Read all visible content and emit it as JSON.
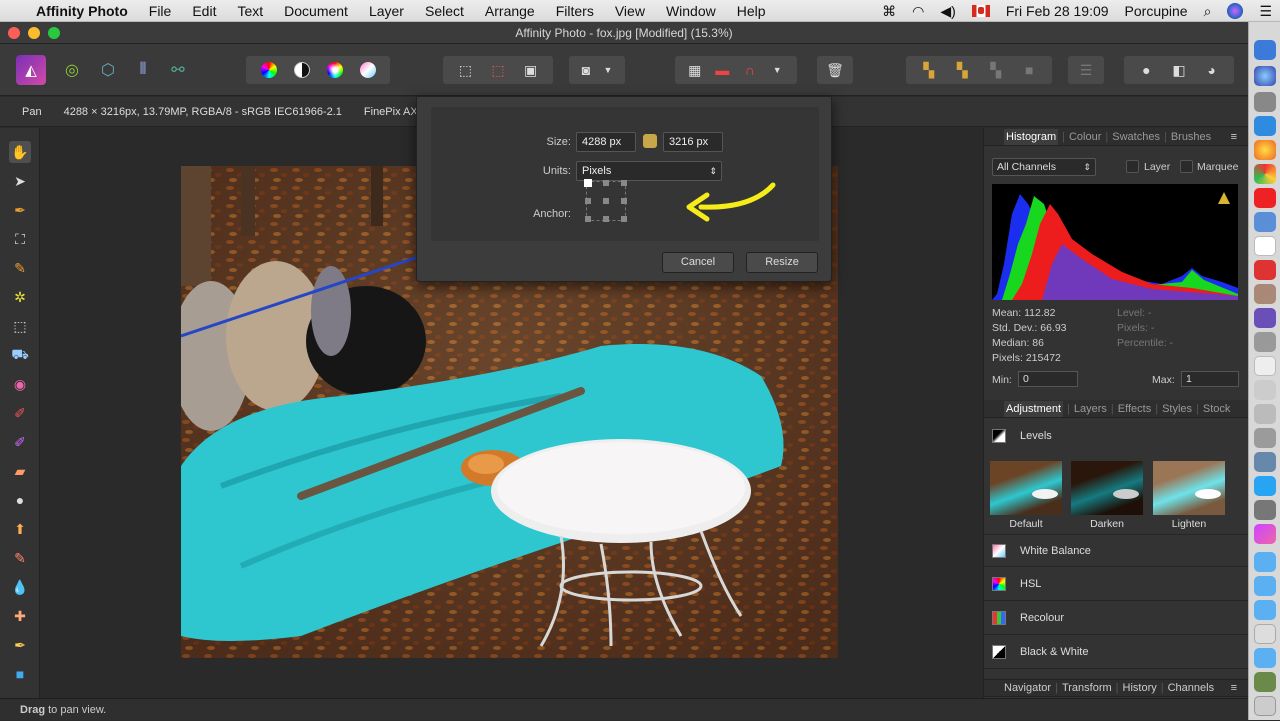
{
  "menubar": {
    "app_name": "Affinity Photo",
    "items": [
      "File",
      "Edit",
      "Text",
      "Document",
      "Layer",
      "Select",
      "Arrange",
      "Filters",
      "View",
      "Window",
      "Help"
    ],
    "datetime": "Fri Feb 28  19:09",
    "user": "Porcupine"
  },
  "window": {
    "title": "Affinity Photo - fox.jpg [Modified] (15.3%)"
  },
  "context_bar": {
    "tool": "Pan",
    "doc_info": "4288 × 3216px, 13.79MP, RGBA/8 - sRGB IEC61966-2.1",
    "camera": "FinePix AX"
  },
  "dialog": {
    "size_label": "Size:",
    "width_value": "4288 px",
    "height_value": "3216 px",
    "units_label": "Units:",
    "units_value": "Pixels",
    "anchor_label": "Anchor:",
    "cancel_label": "Cancel",
    "resize_label": "Resize"
  },
  "histogram_panel": {
    "tabs": [
      "Histogram",
      "Colour",
      "Swatches",
      "Brushes"
    ],
    "channel": "All Channels",
    "layer_label": "Layer",
    "marquee_label": "Marquee",
    "mean": "Mean: 112.82",
    "std_dev": "Std. Dev.: 66.93",
    "median": "Median: 86",
    "pixels": "Pixels: 215472",
    "level": "Level: -",
    "pixels_right": "Pixels: -",
    "percentile": "Percentile: -",
    "min_label": "Min:",
    "min_value": "0",
    "max_label": "Max:",
    "max_value": "1"
  },
  "adjustment_panel": {
    "tabs": [
      "Adjustment",
      "Layers",
      "Effects",
      "Styles",
      "Stock"
    ],
    "levels_label": "Levels",
    "presets": [
      "Default",
      "Darken",
      "Lighten"
    ],
    "items": [
      "White Balance",
      "HSL",
      "Recolour",
      "Black & White"
    ]
  },
  "bottom_tabs": [
    "Navigator",
    "Transform",
    "History",
    "Channels"
  ],
  "status": {
    "bold": "Drag",
    "rest": " to pan view."
  },
  "colors": {
    "accent_arrow": "#f5ec1a",
    "tarp": "#2ec7cf",
    "ui_bg": "#2b2b2b"
  }
}
